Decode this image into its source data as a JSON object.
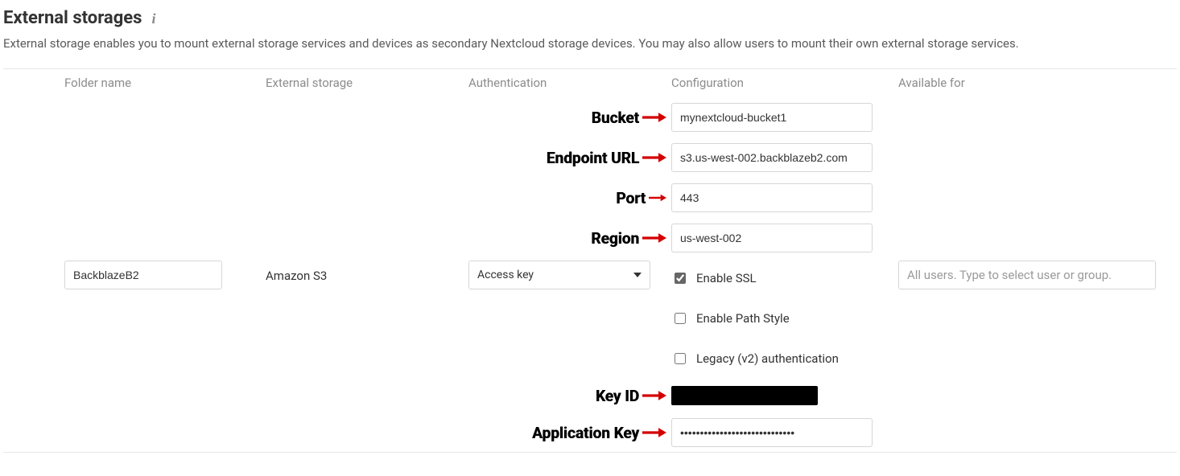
{
  "header": {
    "title": "External storages",
    "description": "External storage enables you to mount external storage services and devices as secondary Nextcloud storage devices. You may also allow users to mount their own external storage services."
  },
  "columns": {
    "folder": "Folder name",
    "backend": "External storage",
    "auth": "Authentication",
    "config": "Configuration",
    "available": "Available for"
  },
  "mount": {
    "folder_name": "BackblazeB2",
    "backend": "Amazon S3",
    "auth_mechanism": "Access key",
    "available_placeholder": "All users. Type to select user or group.",
    "config": {
      "bucket": "mynextcloud-bucket1",
      "hostname": "s3.us-west-002.backblazeb2.com",
      "port": "443",
      "region": "us-west-002",
      "enable_ssl_label": "Enable SSL",
      "enable_ssl": true,
      "path_style_label": "Enable Path Style",
      "path_style": false,
      "legacy_auth_label": "Legacy (v2) authentication",
      "legacy_auth": false,
      "key_id": "",
      "app_key": "•••••••••••••••••••••••••••••"
    }
  },
  "annotations": {
    "bucket": "Bucket",
    "endpoint": "Endpoint URL",
    "port": "Port",
    "region": "Region",
    "key_id": "Key ID",
    "app_key": "Application Key"
  },
  "colors": {
    "arrow": "#d40000"
  }
}
